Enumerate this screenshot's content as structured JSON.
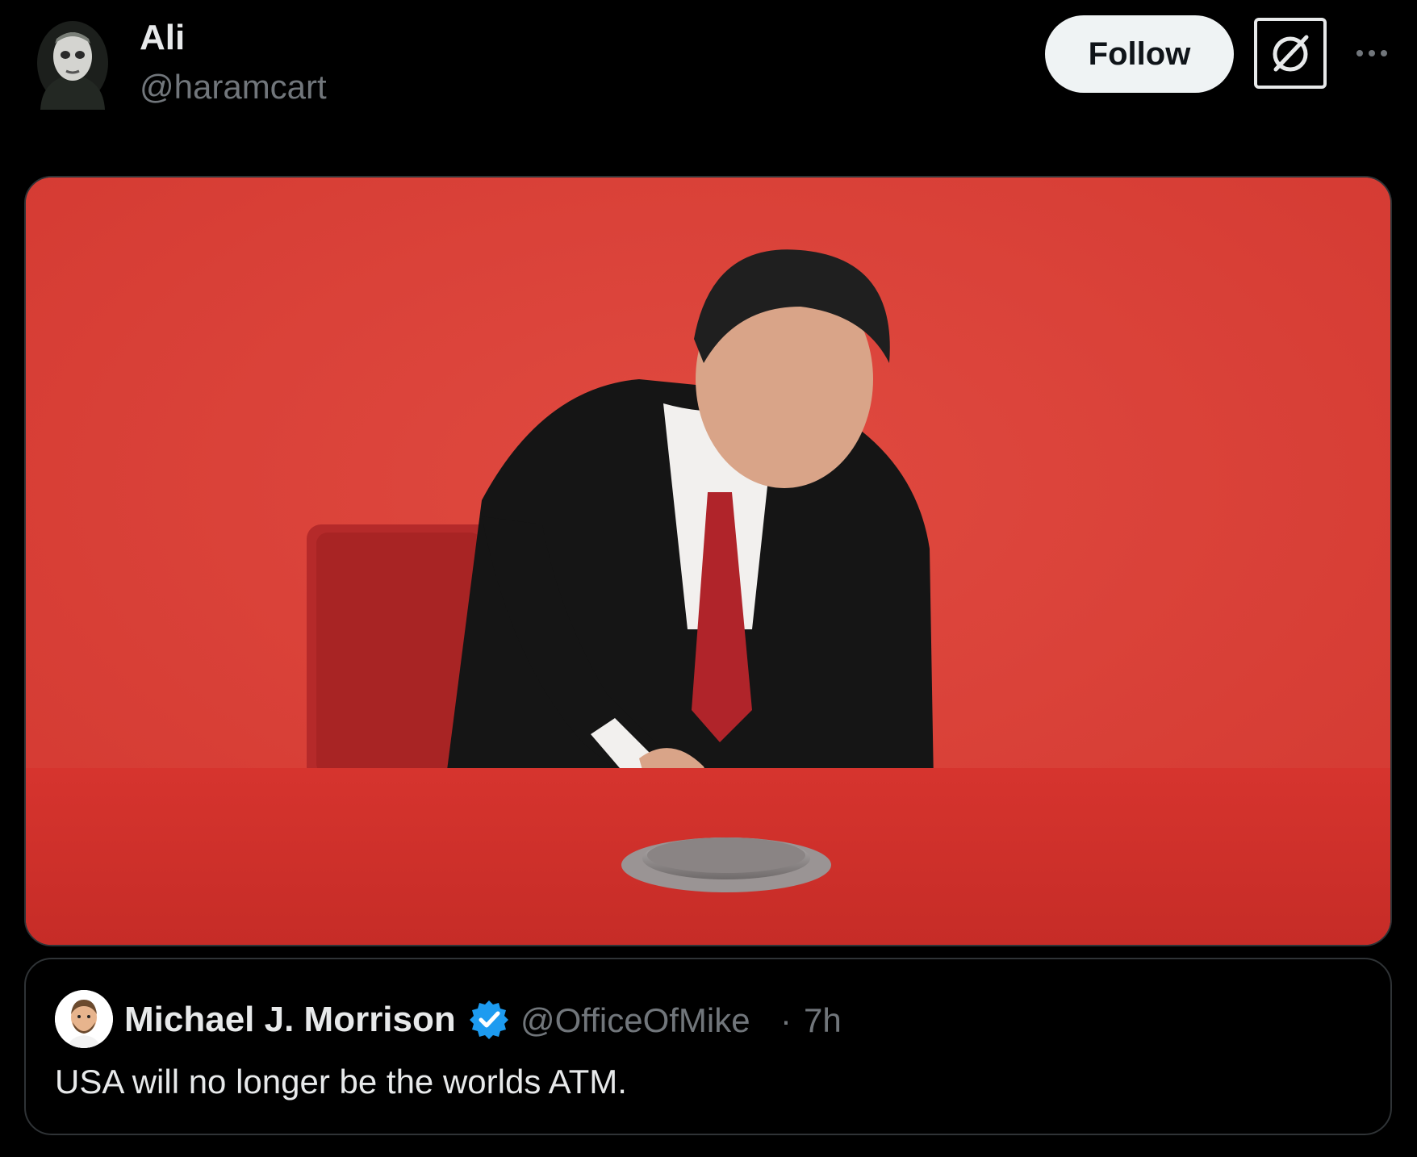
{
  "author": {
    "name": "Ali",
    "handle": "@haramcart"
  },
  "actions": {
    "follow_label": "Follow",
    "grok_icon": "grok-icon",
    "more_icon": "more-icon"
  },
  "media": {
    "icon": "photo",
    "colors": {
      "background": "#d8423a",
      "table": "#c9302a",
      "suit": "#151515",
      "tie": "#b0242a"
    }
  },
  "quoted_post": {
    "name": "Michael J. Morrison",
    "verified": true,
    "handle": "@OfficeOfMike",
    "separator": "·",
    "time": "7h",
    "text": "USA will no longer be the worlds ATM."
  },
  "colors": {
    "background": "#000000",
    "text_primary": "#e7e9ea",
    "text_secondary": "#71767b",
    "border": "#2f3336",
    "verified": "#1d9bf0",
    "follow_bg": "#eff3f4"
  }
}
